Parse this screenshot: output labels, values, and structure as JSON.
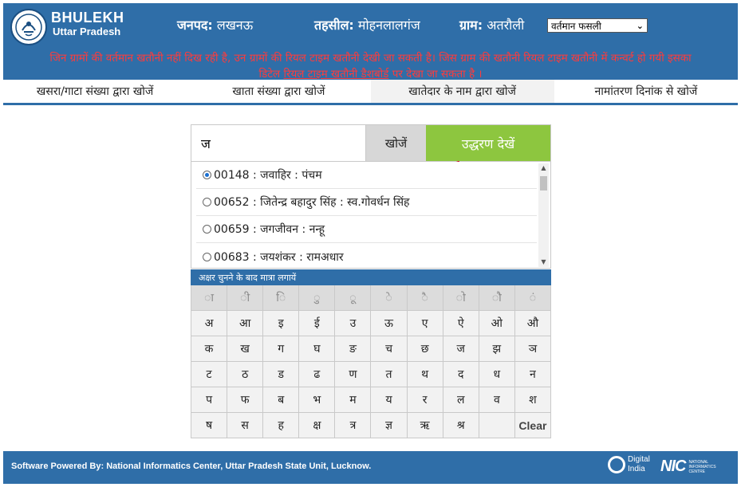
{
  "brand": {
    "title": "BHULEKH",
    "subtitle": "Uttar Pradesh"
  },
  "header": {
    "district_label": "जनपद:",
    "district_value": "लखनऊ",
    "tehsil_label": "तहसील:",
    "tehsil_value": "मोहनलालगंज",
    "village_label": "ग्राम:",
    "village_value": "अतरौली",
    "season_selected": "वर्तमान फसली"
  },
  "notice": {
    "line1": "जिन ग्रामों की वर्तमान खतौनी नहीं दिख रही है, उन ग्रामों की रियल टाइम खतौनी देखी जा सकती है। जिस ग्राम की खतौनी रियल टाइम खतौनी में कन्वर्ट हो गयी इसका",
    "line2_pre": "डिटेल",
    "line2_link": "रियल टाइम खतौनी डैशबोर्ड",
    "line2_post": "पर देखा जा सकता है ।"
  },
  "tabs": [
    {
      "label": "खसरा/गाटा संख्या द्वारा खोजें"
    },
    {
      "label": "खाता संख्या द्वारा खोजें"
    },
    {
      "label": "खातेदार के नाम द्वारा खोजें"
    },
    {
      "label": "नामांतरण दिनांक से खोजें"
    }
  ],
  "search": {
    "value": "ज",
    "search_label": "खोजें",
    "view_label": "उद्धरण देखें"
  },
  "results": [
    {
      "text": "00148 : जवाहिर : पंचम"
    },
    {
      "text": "00652 : जितेन्द्र बहादुर सिंह : स्व.गोवर्धन सिंह"
    },
    {
      "text": "00659 : जगजीवन : नन्हू"
    },
    {
      "text": "00683 : जयशंकर : रामअधार"
    }
  ],
  "keyboard": {
    "header": "अक्षर चुनने के बाद मात्रा लगायें",
    "matras": [
      "ा",
      "ी",
      "ि",
      "ु",
      "ू",
      "े",
      "ै",
      "ो",
      "ौ",
      "ं"
    ],
    "row1": [
      "अ",
      "आ",
      "इ",
      "ई",
      "उ",
      "ऊ",
      "ए",
      "ऐ",
      "ओ",
      "औ"
    ],
    "row2": [
      "क",
      "ख",
      "ग",
      "घ",
      "ङ",
      "च",
      "छ",
      "ज",
      "झ",
      "ञ"
    ],
    "row3": [
      "ट",
      "ठ",
      "ड",
      "ढ",
      "ण",
      "त",
      "थ",
      "द",
      "ध",
      "न"
    ],
    "row4": [
      "प",
      "फ",
      "ब",
      "भ",
      "म",
      "य",
      "र",
      "ल",
      "व",
      "श"
    ],
    "row5": [
      "ष",
      "स",
      "ह",
      "क्ष",
      "त्र",
      "ज्ञ",
      "ऋ",
      "श्र",
      ""
    ],
    "clear_label": "Clear"
  },
  "footer": {
    "text": "Software Powered By: National Informatics Center, Uttar Pradesh State Unit, Lucknow.",
    "digital_india_1": "Digital",
    "digital_india_2": "India",
    "nic": "NIC",
    "nic_sub": "NATIONAL INFORMATICS CENTRE"
  },
  "colors": {
    "primary": "#2f6ea8",
    "accent_green": "#8dc63f",
    "notice_red": "#ff3b3b"
  }
}
